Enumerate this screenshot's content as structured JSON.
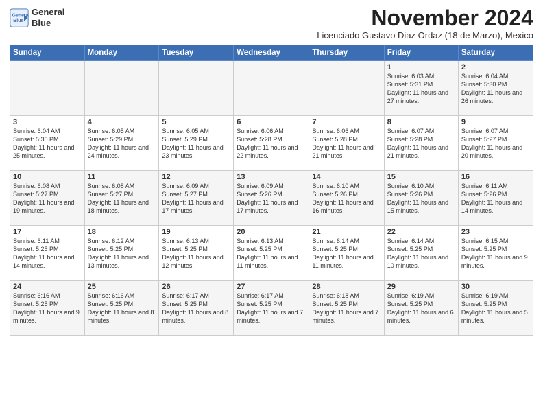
{
  "header": {
    "logo_line1": "General",
    "logo_line2": "Blue",
    "month_title": "November 2024",
    "subtitle": "Licenciado Gustavo Diaz Ordaz (18 de Marzo), Mexico"
  },
  "weekdays": [
    "Sunday",
    "Monday",
    "Tuesday",
    "Wednesday",
    "Thursday",
    "Friday",
    "Saturday"
  ],
  "weeks": [
    [
      {
        "day": "",
        "info": ""
      },
      {
        "day": "",
        "info": ""
      },
      {
        "day": "",
        "info": ""
      },
      {
        "day": "",
        "info": ""
      },
      {
        "day": "",
        "info": ""
      },
      {
        "day": "1",
        "info": "Sunrise: 6:03 AM\nSunset: 5:31 PM\nDaylight: 11 hours and 27 minutes."
      },
      {
        "day": "2",
        "info": "Sunrise: 6:04 AM\nSunset: 5:30 PM\nDaylight: 11 hours and 26 minutes."
      }
    ],
    [
      {
        "day": "3",
        "info": "Sunrise: 6:04 AM\nSunset: 5:30 PM\nDaylight: 11 hours and 25 minutes."
      },
      {
        "day": "4",
        "info": "Sunrise: 6:05 AM\nSunset: 5:29 PM\nDaylight: 11 hours and 24 minutes."
      },
      {
        "day": "5",
        "info": "Sunrise: 6:05 AM\nSunset: 5:29 PM\nDaylight: 11 hours and 23 minutes."
      },
      {
        "day": "6",
        "info": "Sunrise: 6:06 AM\nSunset: 5:28 PM\nDaylight: 11 hours and 22 minutes."
      },
      {
        "day": "7",
        "info": "Sunrise: 6:06 AM\nSunset: 5:28 PM\nDaylight: 11 hours and 21 minutes."
      },
      {
        "day": "8",
        "info": "Sunrise: 6:07 AM\nSunset: 5:28 PM\nDaylight: 11 hours and 21 minutes."
      },
      {
        "day": "9",
        "info": "Sunrise: 6:07 AM\nSunset: 5:27 PM\nDaylight: 11 hours and 20 minutes."
      }
    ],
    [
      {
        "day": "10",
        "info": "Sunrise: 6:08 AM\nSunset: 5:27 PM\nDaylight: 11 hours and 19 minutes."
      },
      {
        "day": "11",
        "info": "Sunrise: 6:08 AM\nSunset: 5:27 PM\nDaylight: 11 hours and 18 minutes."
      },
      {
        "day": "12",
        "info": "Sunrise: 6:09 AM\nSunset: 5:27 PM\nDaylight: 11 hours and 17 minutes."
      },
      {
        "day": "13",
        "info": "Sunrise: 6:09 AM\nSunset: 5:26 PM\nDaylight: 11 hours and 17 minutes."
      },
      {
        "day": "14",
        "info": "Sunrise: 6:10 AM\nSunset: 5:26 PM\nDaylight: 11 hours and 16 minutes."
      },
      {
        "day": "15",
        "info": "Sunrise: 6:10 AM\nSunset: 5:26 PM\nDaylight: 11 hours and 15 minutes."
      },
      {
        "day": "16",
        "info": "Sunrise: 6:11 AM\nSunset: 5:26 PM\nDaylight: 11 hours and 14 minutes."
      }
    ],
    [
      {
        "day": "17",
        "info": "Sunrise: 6:11 AM\nSunset: 5:25 PM\nDaylight: 11 hours and 14 minutes."
      },
      {
        "day": "18",
        "info": "Sunrise: 6:12 AM\nSunset: 5:25 PM\nDaylight: 11 hours and 13 minutes."
      },
      {
        "day": "19",
        "info": "Sunrise: 6:13 AM\nSunset: 5:25 PM\nDaylight: 11 hours and 12 minutes."
      },
      {
        "day": "20",
        "info": "Sunrise: 6:13 AM\nSunset: 5:25 PM\nDaylight: 11 hours and 11 minutes."
      },
      {
        "day": "21",
        "info": "Sunrise: 6:14 AM\nSunset: 5:25 PM\nDaylight: 11 hours and 11 minutes."
      },
      {
        "day": "22",
        "info": "Sunrise: 6:14 AM\nSunset: 5:25 PM\nDaylight: 11 hours and 10 minutes."
      },
      {
        "day": "23",
        "info": "Sunrise: 6:15 AM\nSunset: 5:25 PM\nDaylight: 11 hours and 9 minutes."
      }
    ],
    [
      {
        "day": "24",
        "info": "Sunrise: 6:16 AM\nSunset: 5:25 PM\nDaylight: 11 hours and 9 minutes."
      },
      {
        "day": "25",
        "info": "Sunrise: 6:16 AM\nSunset: 5:25 PM\nDaylight: 11 hours and 8 minutes."
      },
      {
        "day": "26",
        "info": "Sunrise: 6:17 AM\nSunset: 5:25 PM\nDaylight: 11 hours and 8 minutes."
      },
      {
        "day": "27",
        "info": "Sunrise: 6:17 AM\nSunset: 5:25 PM\nDaylight: 11 hours and 7 minutes."
      },
      {
        "day": "28",
        "info": "Sunrise: 6:18 AM\nSunset: 5:25 PM\nDaylight: 11 hours and 7 minutes."
      },
      {
        "day": "29",
        "info": "Sunrise: 6:19 AM\nSunset: 5:25 PM\nDaylight: 11 hours and 6 minutes."
      },
      {
        "day": "30",
        "info": "Sunrise: 6:19 AM\nSunset: 5:25 PM\nDaylight: 11 hours and 5 minutes."
      }
    ]
  ]
}
